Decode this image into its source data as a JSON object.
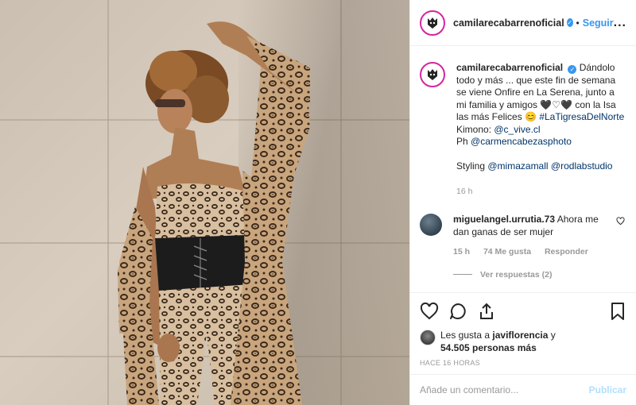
{
  "header": {
    "username": "camilarecabarrenoficial",
    "follow_label": "Seguir",
    "separator": "•",
    "more_label": "..."
  },
  "caption": {
    "username": "camilarecabarrenoficial",
    "text_main": "Dándolo todo y más ... que este fin de semana se viene Onfire en La Serena, junto a mi familia y amigos 🖤♡🖤 con la Isa las más Felices 😊",
    "hashtag": "#LaTigresaDelNorte",
    "kimono_label": "Kimono:",
    "kimono_mention": "@c_vive.cl",
    "ph_label": "Ph",
    "ph_mention": "@carmencabezasphoto",
    "styling_label": "Styling",
    "styling_mention1": "@mimazamall",
    "styling_mention2": "@rodlabstudio",
    "time": "16 h"
  },
  "comment": {
    "username": "miguelangel.urrutia.73",
    "text": "Ahora me dan ganas de ser mujer",
    "time": "15 h",
    "likes": "74 Me gusta",
    "reply": "Responder",
    "view_replies": "Ver respuestas (2)"
  },
  "likes": {
    "prefix": "Les gusta a",
    "user": "javiflorencia",
    "conj": "y",
    "count": "54.505 personas más"
  },
  "posted": "HACE 16 HORAS",
  "add_comment": {
    "placeholder": "Añade un comentario...",
    "publish": "Publicar"
  },
  "icons": {
    "like": "heart-icon",
    "comment": "comment-icon",
    "share": "share-icon",
    "save": "bookmark-icon"
  },
  "colors": {
    "accent": "#3897f0",
    "link": "#003569",
    "muted": "#999999",
    "publish_disabled": "#b2dffc"
  }
}
